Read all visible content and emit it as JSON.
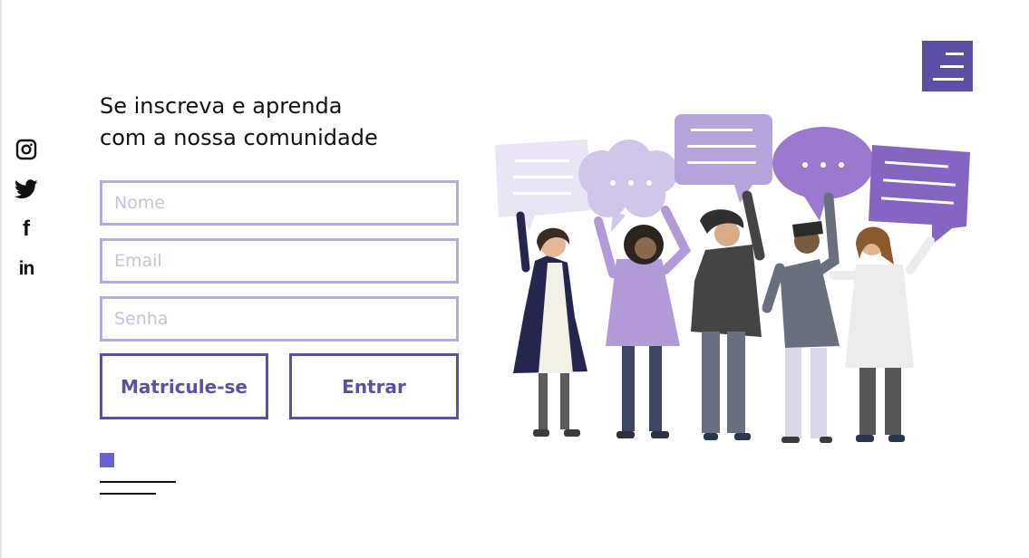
{
  "header": {
    "menu_icon": "hamburger-menu-icon",
    "menu_color": "#5b4fa6"
  },
  "social": [
    {
      "name": "instagram",
      "icon": "instagram-icon"
    },
    {
      "name": "twitter",
      "icon": "twitter-icon"
    },
    {
      "name": "facebook",
      "icon": "facebook-icon",
      "glyph": "f"
    },
    {
      "name": "linkedin",
      "icon": "linkedin-icon",
      "glyph": "in"
    }
  ],
  "hero": {
    "title_line1": "Se inscreva e aprenda",
    "title_line2": "com a nossa comunidade"
  },
  "form": {
    "name_placeholder": "Nome",
    "email_placeholder": "Email",
    "password_placeholder": "Senha",
    "signup_label": "Matricule-se",
    "login_label": "Entrar"
  },
  "colors": {
    "accent": "#5b4fa6",
    "input_border": "#b7a8de",
    "placeholder": "#c9bfe9",
    "deco_square": "#6a62d2"
  },
  "illustration": {
    "description_icon": "community-people-speech-bubbles-illustration"
  }
}
